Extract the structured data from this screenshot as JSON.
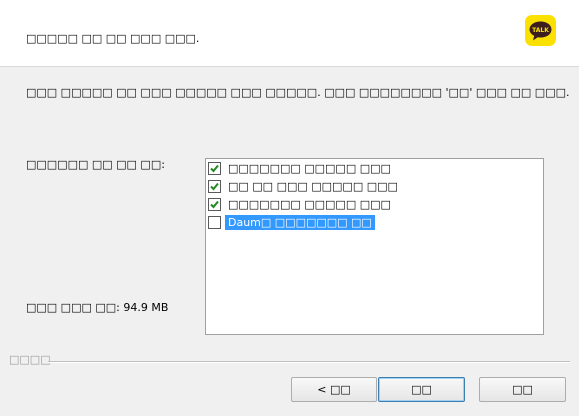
{
  "header": {
    "title": "□□□□□ □□ □□ □□□ □□□."
  },
  "logo": {
    "text": "TALK"
  },
  "instruction": "□□□ □□□□□ □□ □□□ □□□□□ □□□ □□□□□. □□□ □□□□□□□□ '□□' □□□ □□ □□□.",
  "components": {
    "label": "□□□□□□ □□ □□ □□:",
    "items": [
      {
        "label": "□□□□□□□ □□□□□ □□□",
        "checked": true,
        "selected": false
      },
      {
        "label": "□□ □□ □□□ □□□□□ □□□",
        "checked": true,
        "selected": false
      },
      {
        "label": "□□□□□□□ □□□□□ □□□",
        "checked": true,
        "selected": false
      },
      {
        "label": "Daum□ □□□□□□□ □□",
        "checked": false,
        "selected": true
      }
    ]
  },
  "space_required": "□□□ □□□ □□: 94.9 MB",
  "footer": {
    "brand": "□□□□"
  },
  "buttons": {
    "back": "< □□",
    "next": "□□",
    "cancel": "□□"
  },
  "colors": {
    "logo_bg": "#fae100",
    "selection": "#3399ff",
    "check": "#1f8a1f"
  }
}
